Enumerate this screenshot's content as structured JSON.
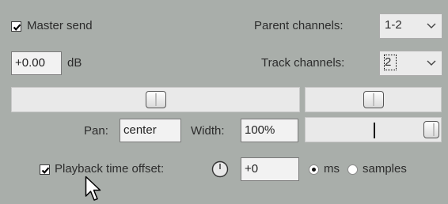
{
  "master_send": {
    "label": "Master send",
    "checked": true
  },
  "parent_channels": {
    "label": "Parent channels:",
    "value": "1-2"
  },
  "volume": {
    "value": "+0.00",
    "unit": "dB"
  },
  "track_channels": {
    "label": "Track channels:",
    "value": "2"
  },
  "volume_fader": {
    "level": 0.5
  },
  "pan_fader": {
    "level": 0.5
  },
  "pan": {
    "label": "Pan:",
    "value": "center"
  },
  "width": {
    "label": "Width:",
    "value": "100%"
  },
  "width_fader": {
    "level": 1.0
  },
  "playback_offset": {
    "label": "Playback time offset:",
    "checked": true,
    "value": "+0"
  },
  "units": {
    "ms_label": "ms",
    "samples_label": "samples",
    "selected": "ms"
  },
  "icons": {
    "checkmark": "check-icon",
    "dropdown": "chevron-down-icon",
    "clock": "clock-icon",
    "cursor": "mouse-pointer-icon"
  }
}
